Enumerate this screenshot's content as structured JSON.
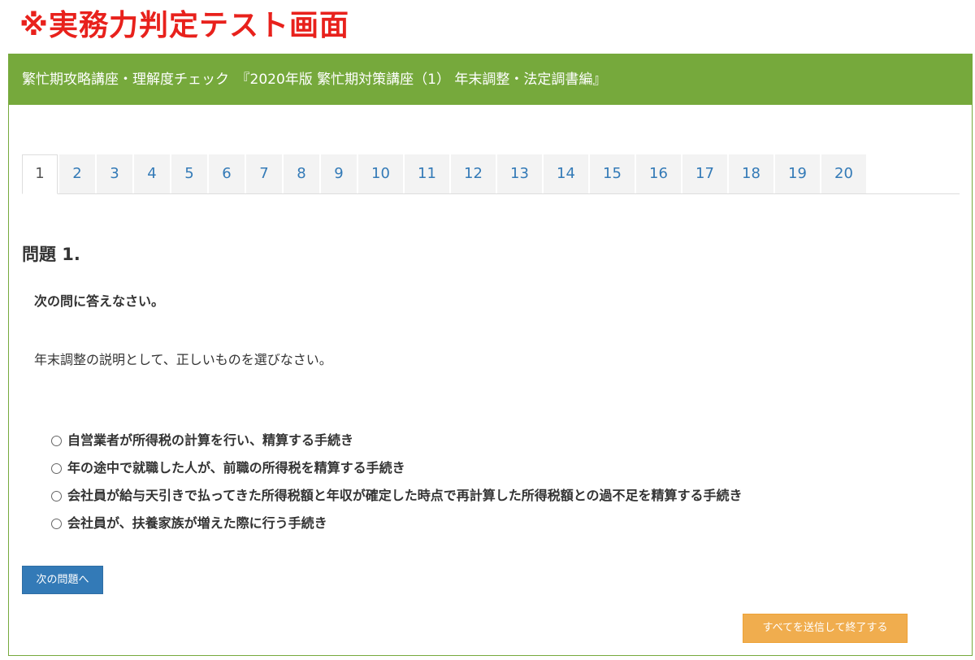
{
  "banner": "※実務力判定テスト画面",
  "header": {
    "title": "繁忙期攻略講座・理解度チェック　『2020年版 繁忙期対策講座（1） 年末調整・法定調書編』"
  },
  "tabs": [
    "1",
    "2",
    "3",
    "4",
    "5",
    "6",
    "7",
    "8",
    "9",
    "10",
    "11",
    "12",
    "13",
    "14",
    "15",
    "16",
    "17",
    "18",
    "19",
    "20"
  ],
  "active_tab": "1",
  "question": {
    "title": "問題 1.",
    "lead": "次の問に答えなさい。",
    "text": "年末調整の説明として、正しいものを選びなさい。",
    "choices": [
      "自営業者が所得税の計算を行い、精算する手続き",
      "年の途中で就職した人が、前職の所得税を精算する手続き",
      "会社員が給与天引きで払ってきた所得税額と年収が確定した時点で再計算した所得税額との過不足を精算する手続き",
      "会社員が、扶養家族が増えた際に行う手続き"
    ]
  },
  "buttons": {
    "next": "次の問題へ",
    "submit_all": "すべてを送信して終了する"
  },
  "colors": {
    "banner": "#e8211c",
    "header_bg": "#76a93c",
    "tab_link": "#337ab7",
    "next_button": "#337ab7",
    "submit_button": "#f0ad4e"
  }
}
